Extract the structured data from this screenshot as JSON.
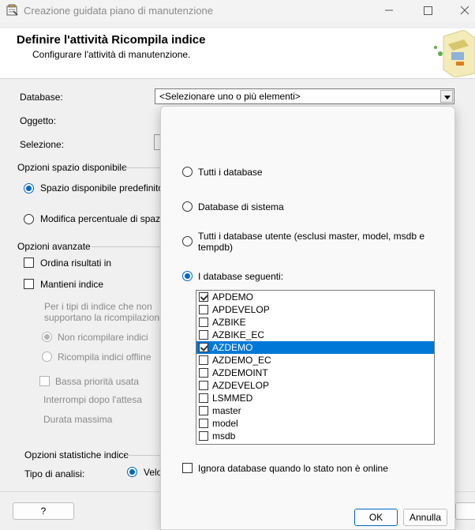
{
  "window": {
    "title": "Creazione guidata piano di manutenzione"
  },
  "header": {
    "title": "Definire l'attività Ricompila indice",
    "subtitle": "Configurare l'attività di manutenzione."
  },
  "form": {
    "database_label": "Database:",
    "database_value": "<Selezionare uno o più elementi>",
    "object_label": "Oggetto:",
    "selection_label": "Selezione:"
  },
  "free_space": {
    "group_label": "Opzioni spazio disponibile",
    "default_label": "Spazio disponibile predefinito p",
    "default_selected": true,
    "percent_label": "Modifica percentuale di spazio",
    "percent_selected": false
  },
  "advanced": {
    "group_label": "Opzioni avanzate",
    "sort_label": "Ordina risultati in",
    "keep_index_label": "Mantieni indice",
    "note_line1": "Per i tipi di indice che non",
    "note_line2": "supportano la ricompilazione o",
    "no_rebuild_label": "Non ricompilare indici",
    "no_rebuild_selected": true,
    "offline_label": "Ricompila indici offline",
    "low_priority_label": "Bassa priorità usata",
    "abort_wait_label": "Interrompi dopo l'attesa",
    "max_duration_label": "Durata massima"
  },
  "statistics": {
    "group_label": "Opzioni statistiche indice",
    "analysis_label": "Tipo di analisi:",
    "analysis_value": "Velo"
  },
  "footer": {
    "help_label": "?"
  },
  "popup": {
    "options": [
      {
        "label": "Tutti i database",
        "selected": false
      },
      {
        "label": "Database di sistema",
        "selected": false
      },
      {
        "label_line1": "Tutti i database utente (esclusi master, model, msdb e",
        "label_line2": "tempdb)",
        "selected": false
      },
      {
        "label": "I database seguenti:",
        "selected": true
      }
    ],
    "databases": [
      {
        "name": "APDEMO",
        "checked": true,
        "highlighted": false
      },
      {
        "name": "APDEVELOP",
        "checked": false,
        "highlighted": false
      },
      {
        "name": "AZBIKE",
        "checked": false,
        "highlighted": false
      },
      {
        "name": "AZBIKE_EC",
        "checked": false,
        "highlighted": false
      },
      {
        "name": "AZDEMO",
        "checked": true,
        "highlighted": true
      },
      {
        "name": "AZDEMO_EC",
        "checked": false,
        "highlighted": false
      },
      {
        "name": "AZDEMOINT",
        "checked": false,
        "highlighted": false
      },
      {
        "name": "AZDEVELOP",
        "checked": false,
        "highlighted": false
      },
      {
        "name": "LSMMED",
        "checked": false,
        "highlighted": false
      },
      {
        "name": "master",
        "checked": false,
        "highlighted": false
      },
      {
        "name": "model",
        "checked": false,
        "highlighted": false
      },
      {
        "name": "msdb",
        "checked": false,
        "highlighted": false
      }
    ],
    "ignore_offline_label": "Ignora database quando lo stato non è online",
    "ok_label": "OK",
    "cancel_label": "Annulla"
  },
  "colors": {
    "accent": "#0067c0",
    "selection": "#0078d7"
  }
}
